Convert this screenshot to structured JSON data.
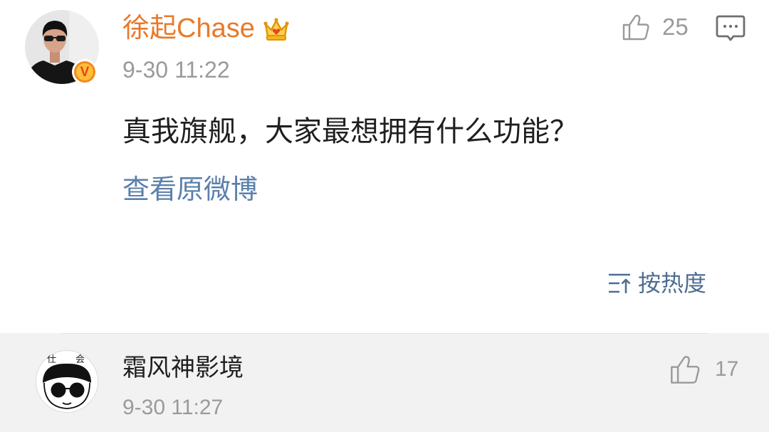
{
  "root_comment": {
    "author": {
      "name": "徐起Chase",
      "avatar": "avatar-photo",
      "verified_badge": "V",
      "member_icon": "crown-icon"
    },
    "timestamp": "9-30 11:22",
    "like_icon": "like-icon",
    "likes": "25",
    "reply_icon": "comment-icon",
    "text": "真我旗舰，大家最想拥有什么功能？",
    "view_original_link": "查看原微博"
  },
  "sort": {
    "icon": "sort-icon",
    "label": "按热度"
  },
  "replies": [
    {
      "name": "霜风神影境",
      "avatar": "cartoon-avatar",
      "avatar_lettering": [
        "仕",
        "会"
      ],
      "timestamp": "9-30 11:27",
      "like_icon": "like-icon",
      "likes": "17"
    }
  ],
  "colors": {
    "accent_orange": "#e8792a",
    "link_blue": "#5b80ab",
    "sort_blue": "#4e6d92",
    "meta_gray": "#9a9a9a",
    "icon_gray": "#9a9a9a",
    "text_dark": "#1f1f1f",
    "divider": "#e2e2e2",
    "reply_bg": "#f2f2f2"
  }
}
